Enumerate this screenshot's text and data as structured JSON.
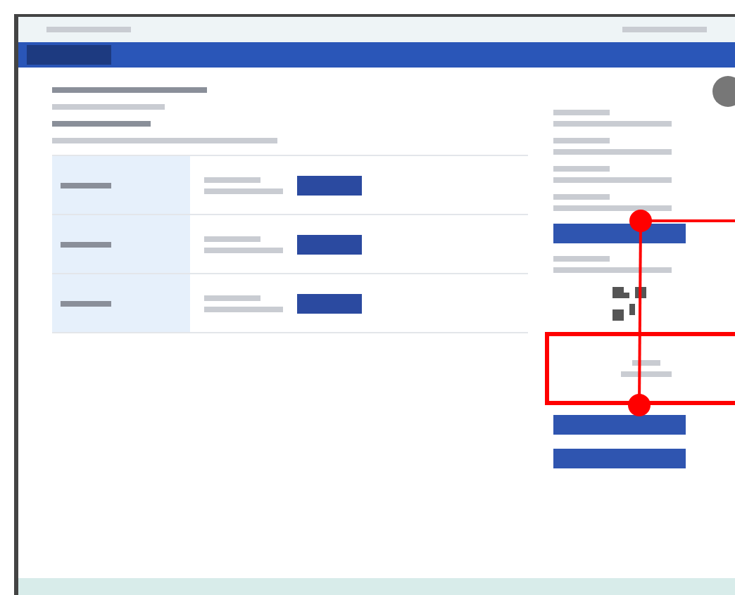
{
  "table_rows": [
    {
      "kind": "button_row"
    },
    {
      "kind": "button_row"
    },
    {
      "kind": "button_row"
    }
  ],
  "sidebar": [
    {
      "kind": "text"
    },
    {
      "kind": "text"
    },
    {
      "kind": "text"
    },
    {
      "kind": "text"
    },
    {
      "kind": "button"
    },
    {
      "kind": "text"
    },
    {
      "kind": "qr"
    },
    {
      "kind": "highlight_box"
    },
    {
      "kind": "button"
    },
    {
      "kind": "button"
    }
  ]
}
